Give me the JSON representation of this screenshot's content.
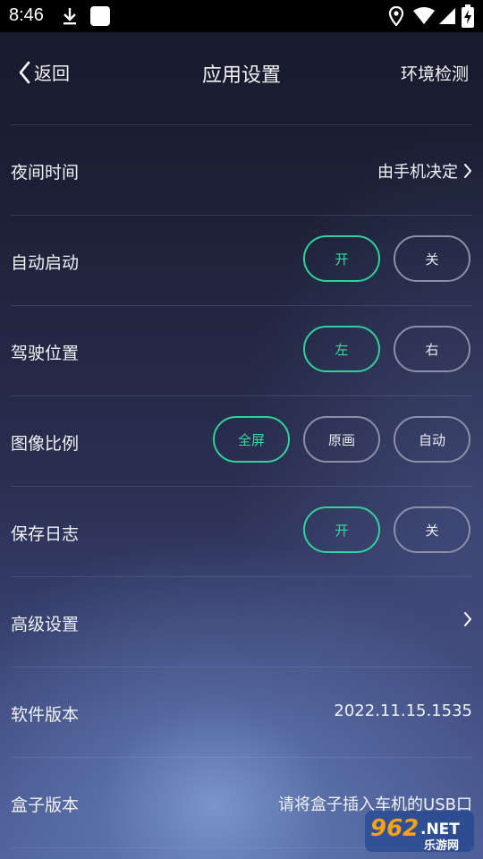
{
  "status_bar": {
    "time": "8:46"
  },
  "header": {
    "back_label": "返回",
    "title": "应用设置",
    "right_action": "环境检测"
  },
  "rows": {
    "night_time": {
      "label": "夜间时间",
      "value": "由手机决定"
    },
    "auto_start": {
      "label": "自动启动",
      "options": [
        "开",
        "关"
      ],
      "selected": "开"
    },
    "driving_position": {
      "label": "驾驶位置",
      "options": [
        "左",
        "右"
      ],
      "selected": "左"
    },
    "image_ratio": {
      "label": "图像比例",
      "options": [
        "全屏",
        "原画",
        "自动"
      ],
      "selected": "全屏"
    },
    "save_log": {
      "label": "保存日志",
      "options": [
        "开",
        "关"
      ],
      "selected": "开"
    },
    "advanced": {
      "label": "高级设置"
    },
    "software_version": {
      "label": "软件版本",
      "value": "2022.11.15.1535"
    },
    "box_version": {
      "label": "盒子版本",
      "value": "请将盒子插入车机的USB口"
    }
  },
  "watermark": {
    "number": "962",
    "suffix": ".NET",
    "caption": "乐游网"
  },
  "colors": {
    "accent": "#2fd39a",
    "inactive_border": "#8a90a8",
    "status_bar": "#000000"
  }
}
